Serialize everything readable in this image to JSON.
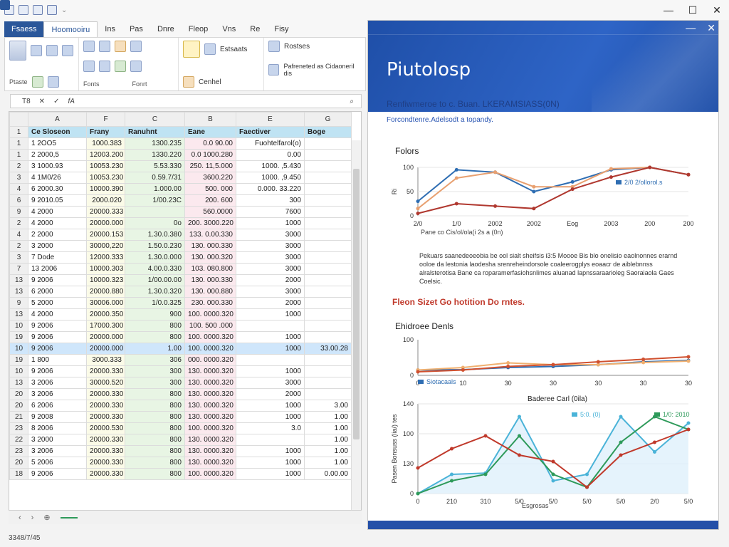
{
  "titlebar": {
    "qat_icons": [
      "app-icon",
      "save-icon",
      "undo-icon",
      "redo-icon",
      "touch-icon"
    ],
    "controls": [
      "—",
      "☐",
      "✕"
    ]
  },
  "tabs": [
    "Fsaess",
    "Hoomooiru",
    "Ins",
    "Pas",
    "Dnre",
    "Fleop",
    "Vns",
    "Re",
    "Fisy"
  ],
  "ribbon": {
    "clipboard_label": "Ptaste",
    "group1_label": "Fonts",
    "group2_label": "Fonrt",
    "style_labels": [
      "Estsaats",
      "Cenhel"
    ],
    "cond_labels": [
      "Rostses",
      "Pafreneted as Cidaoneril dis"
    ]
  },
  "formula_bar": {
    "namebox": "T8",
    "fx": "fA"
  },
  "sheet": {
    "columns": [
      "A",
      "F",
      "C",
      "B",
      "E",
      "G"
    ],
    "header": [
      "Ce Sloseon",
      "Frany",
      "Ranuhnt",
      "Eane",
      "Faectiver",
      "Boge"
    ],
    "rows": [
      [
        "1",
        "2OO5",
        "1000.383",
        "1300.235",
        "0.0 90.00",
        "Fuohtelfarol(o)",
        ""
      ],
      [
        "2",
        "2000,5",
        "12003.200",
        "1330.220",
        "0.0 1000.280",
        "0.00",
        ""
      ],
      [
        "3",
        "1000.93",
        "10053.230",
        "5.53.330",
        "250. 11,5.000",
        "1000. ,5.430",
        ""
      ],
      [
        "4",
        "1M0/26",
        "10053.230",
        "0.59.7/31",
        "3600.220",
        "1000. ,9.450",
        ""
      ],
      [
        "6",
        "2000.30",
        "10000.390",
        "1.000.00",
        "500. 000",
        "0.000. 33.220",
        ""
      ],
      [
        "9",
        "2010.05",
        "2000.020",
        "1/00.23C",
        "200. 600",
        "300",
        ""
      ],
      [
        "4",
        "2000",
        "20000.333",
        "",
        "560.0000",
        "7600",
        ""
      ],
      [
        "4",
        "2000",
        "20000.000",
        "0o",
        "200. 3000.220",
        "1000",
        ""
      ],
      [
        "2",
        "2000",
        "20000.153",
        "1.30.0.380",
        "133. 0.00.330",
        "3000",
        ""
      ],
      [
        "3",
        "2000",
        "30000,220",
        "1.50.0.230",
        "130. 000.330",
        "3000",
        ""
      ],
      [
        "7",
        "Dode",
        "12000.333",
        "1.30.0.000",
        "130. 000.320",
        "3000",
        ""
      ],
      [
        "13",
        "2006",
        "10000.303",
        "4.00.0.330",
        "103. 080.800",
        "3000",
        ""
      ],
      [
        "9",
        "2006",
        "10000.323",
        "1/00.00.00",
        "130. 000.330",
        "2000",
        ""
      ],
      [
        "6",
        "2000",
        "20000.880",
        "1.30.0.320",
        "130. 000.880",
        "3000",
        ""
      ],
      [
        "5",
        "2000",
        "30006.000",
        "1/0.0.325",
        "230. 000.330",
        "2000",
        ""
      ],
      [
        "4",
        "2000",
        "20000.350",
        "900",
        "100. 0000.320",
        "1000",
        ""
      ],
      [
        "9",
        "2006",
        "17000.300",
        "800",
        "100. 500 .000",
        "",
        ""
      ],
      [
        "9",
        "2006",
        "20000.000",
        "800",
        "100. 0000.320",
        "1000",
        ""
      ],
      [
        "9",
        "2006",
        "20000.000",
        "1.00",
        "100. 0000.320",
        "1000",
        "33.00.28"
      ],
      [
        "1",
        "800",
        "3000.333",
        "306",
        "000. 0000.320",
        "",
        ""
      ],
      [
        "9",
        "2006",
        "20000.330",
        "300",
        "130. 0000.320",
        "1000",
        ""
      ],
      [
        "3",
        "2006",
        "30000.520",
        "300",
        "130. 0000.320",
        "3000",
        ""
      ],
      [
        "3",
        "2006",
        "20000.330",
        "800",
        "130. 0000.320",
        "2000",
        ""
      ],
      [
        "6",
        "2006",
        "20000.330",
        "800",
        "130. 0000.320",
        "1000",
        "3.00"
      ],
      [
        "9",
        "2008",
        "20000.330",
        "800",
        "130. 0000.320",
        "1000",
        "1.00"
      ],
      [
        "8",
        "2006",
        "20000.530",
        "800",
        "100. 0000.320",
        "3.0",
        "1.00"
      ],
      [
        "3",
        "2000",
        "20000.330",
        "800",
        "130. 0000.320",
        "",
        "1.00"
      ],
      [
        "3",
        "2006",
        "20000.330",
        "800",
        "130. 0000.320",
        "1000",
        "1.00"
      ],
      [
        "5",
        "2006",
        "20000.330",
        "800",
        "130. 0000.320",
        "1000",
        "1.00"
      ],
      [
        "9",
        "2006",
        "20000.330",
        "800",
        "100. 0000.320",
        "1000",
        "0.00.00"
      ]
    ],
    "row_numbers": [
      "1",
      "1",
      "2",
      "3",
      "4",
      "6",
      "9",
      "2",
      "4",
      "2",
      "3",
      "7",
      "13",
      "13",
      "9",
      "13",
      "10",
      "19",
      "10",
      "19",
      "10",
      "13",
      "20",
      "20",
      "21",
      "23",
      "22",
      "23",
      "20",
      "18"
    ],
    "selected_row_index": 18
  },
  "status": "3348/7/45",
  "report": {
    "title": "Piutolosp",
    "subtitle": "Renfiwmeroe to c. Buan. LKERAMSIASS(0N)",
    "caption": "Forcondtenre.Adelsodt a topandy.",
    "chart1": {
      "title": "Folors",
      "ylabel": "Ri",
      "yticks": [
        "100",
        "50",
        "0"
      ],
      "xticks": [
        "2/0",
        "1/0",
        "2002",
        "2002",
        "Eog",
        "2003",
        "200",
        "200"
      ],
      "xlabel": "Pane co Cis/ol/ola(i 2s a (0n)",
      "legend": "2/0 2/ollorol.s"
    },
    "paragraph": "Pekuars saanedeoeobia be ool sialt sheifsis i3:5 Moooe Bis blo onelisio eaolnonnes erarnd ooloe da lestonia laodesha srenreheindorsole coaleerogplys eoaacr de aiblebnnss alralsterotisa Bane ca roparamerfasiohsnlimes aluanad lapnssaraarioleg Saoraiaola Gaes Coelsic.",
    "section_red": "Fleon Sizet Go hotition Do rntes.",
    "chart2": {
      "title": "Ehidroee Denls",
      "yticks": [
        "100",
        "0"
      ],
      "xticks": [
        "0",
        "10",
        "30",
        "30",
        "30",
        "30",
        "30"
      ],
      "legend": "Siotacaals"
    },
    "chart3": {
      "title": "Baderee Carl (0ila)",
      "ylabel": "Pasen Bonsuss (lia/) tes",
      "yticks": [
        "140",
        "100",
        "130",
        "0"
      ],
      "xticks": [
        "0",
        "210",
        "310",
        "5/0",
        "5/0",
        "5/0",
        "5/0",
        "2/0",
        "5/0"
      ],
      "xlabel": "Esgrosas",
      "legend1": "5:0. (0)",
      "legend2": "1/0: 2010"
    }
  },
  "chart_data": [
    {
      "type": "line",
      "title": "Folors",
      "categories": [
        "2/0",
        "1/0",
        "2002",
        "2002",
        "Eog",
        "2003",
        "200",
        "200"
      ],
      "series": [
        {
          "name": "2/0 2/ollorol.s",
          "color": "#2e6db2",
          "values": [
            30,
            95,
            90,
            50,
            70,
            95,
            100,
            85
          ]
        },
        {
          "name": "",
          "color": "#e8a070",
          "values": [
            15,
            78,
            90,
            60,
            60,
            97,
            100,
            85
          ]
        },
        {
          "name": "",
          "color": "#b0382f",
          "values": [
            5,
            25,
            20,
            15,
            55,
            80,
            100,
            85
          ]
        }
      ],
      "ylim": [
        0,
        100
      ],
      "xlabel": "Pane co Cis/ol/ola(i 2s a (0n)",
      "ylabel": "Ri"
    },
    {
      "type": "line",
      "title": "Ehidroee Denls",
      "categories": [
        "0",
        "10",
        "30",
        "30",
        "30",
        "30",
        "30"
      ],
      "series": [
        {
          "name": "Siotacaals",
          "color": "#2e6db2",
          "values": [
            15,
            16,
            22,
            25,
            30,
            38,
            42
          ]
        },
        {
          "name": "",
          "color": "#f0b070",
          "values": [
            15,
            22,
            35,
            30,
            30,
            36,
            40
          ]
        },
        {
          "name": "",
          "color": "#d0502f",
          "values": [
            10,
            15,
            25,
            30,
            38,
            45,
            52
          ]
        }
      ],
      "ylim": [
        0,
        100
      ]
    },
    {
      "type": "line",
      "title": "Baderee Carl (0ila)",
      "categories": [
        "0",
        "210",
        "310",
        "5/0",
        "5/0",
        "5/0",
        "5/0",
        "2/0",
        "5/0"
      ],
      "series": [
        {
          "name": "5:0. (0)",
          "color": "#4ab3d8",
          "values": [
            0,
            30,
            32,
            120,
            20,
            30,
            120,
            65,
            110
          ]
        },
        {
          "name": "1/0: 2010",
          "color": "#2e9a5a",
          "values": [
            0,
            20,
            30,
            90,
            30,
            10,
            80,
            120,
            100
          ]
        },
        {
          "name": "",
          "color": "#c0392b",
          "values": [
            40,
            70,
            90,
            60,
            50,
            10,
            60,
            80,
            100
          ]
        }
      ],
      "ylim": [
        0,
        140
      ]
    }
  ]
}
